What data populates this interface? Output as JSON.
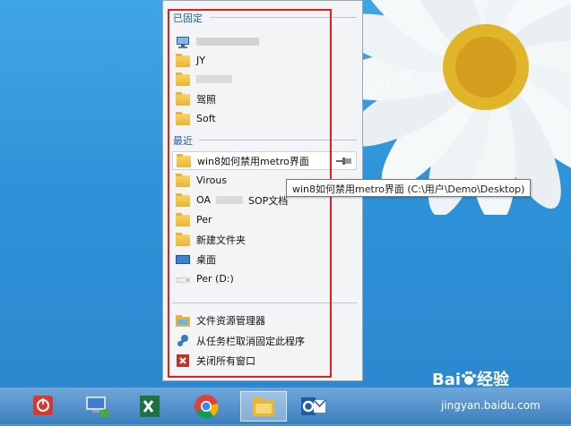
{
  "jumplist": {
    "pinned_header": "已固定",
    "recent_header": "最近",
    "pinned": [
      {
        "label": "",
        "icon": "computer-icon"
      },
      {
        "label": "JY",
        "icon": "folder-icon"
      },
      {
        "label": "",
        "icon": "folder-icon"
      },
      {
        "label": "驾照",
        "icon": "folder-icon"
      },
      {
        "label": "Soft",
        "icon": "folder-icon"
      }
    ],
    "recent": [
      {
        "label": "win8如何禁用metro界面",
        "icon": "folder-icon"
      },
      {
        "label": "Virous",
        "icon": "folder-icon"
      },
      {
        "label": "OA",
        "label_suffix": "SOP文档",
        "icon": "folder-icon"
      },
      {
        "label": "Per",
        "icon": "folder-icon"
      },
      {
        "label": "新建文件夹",
        "icon": "folder-icon"
      },
      {
        "label": "桌面",
        "icon": "desktop-icon"
      },
      {
        "label": "Per (D:)",
        "icon": "drive-icon"
      }
    ],
    "tasks": [
      {
        "label": "文件资源管理器",
        "icon": "explorer-icon"
      },
      {
        "label": "从任务栏取消固定此程序",
        "icon": "unpin-icon"
      },
      {
        "label": "关闭所有窗口",
        "icon": "close-window-icon"
      }
    ]
  },
  "tooltip": "win8如何禁用metro界面 (C:\\用户\\Demo\\Desktop)",
  "taskbar": [
    {
      "name": "power-icon"
    },
    {
      "name": "network-computer-icon"
    },
    {
      "name": "excel-icon"
    },
    {
      "name": "chrome-icon"
    },
    {
      "name": "file-explorer-icon"
    },
    {
      "name": "outlook-icon"
    }
  ],
  "watermark": {
    "brand_text": "Bai",
    "brand_suffix": "经验",
    "url": "jingyan.baidu.com",
    "faint_text": "百度经验"
  },
  "colors": {
    "highlight_border": "#e12020",
    "section_header": "#1f5fa8",
    "desktop_blue": "#3aa0e0"
  }
}
